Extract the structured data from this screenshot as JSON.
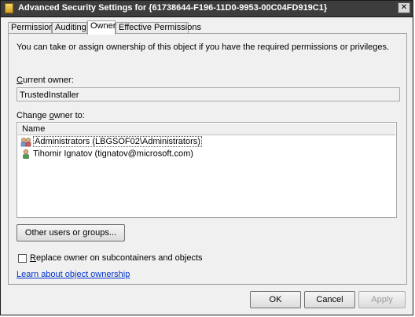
{
  "window": {
    "title": "Advanced Security Settings for {61738644-F196-11D0-9953-00C04FD919C1}",
    "close_glyph": "✕"
  },
  "tabs": [
    "Permissions",
    "Auditing",
    "Owner",
    "Effective Permissions"
  ],
  "active_tab": "Owner",
  "owner": {
    "intro": "You can take or assign ownership of this object if you have the required permissions or privileges.",
    "current_owner_label": "Current owner:",
    "current_owner_value": "TrustedInstaller",
    "change_owner_label": "Change owner to:",
    "column_name": "Name",
    "candidates": [
      {
        "name": "Administrators (LBGSOF02\\Administrators)",
        "icon": "group-icon",
        "selected": true
      },
      {
        "name": "Tihomir Ignatov (tignatov@microsoft.com)",
        "icon": "user-icon",
        "selected": false
      }
    ],
    "other_users_button": "Other users or groups...",
    "replace_owner_label": "Replace owner on subcontainers and objects",
    "replace_owner_checked": false,
    "learn_link": "Learn about object ownership"
  },
  "footer": {
    "ok": "OK",
    "cancel": "Cancel",
    "apply": "Apply"
  }
}
